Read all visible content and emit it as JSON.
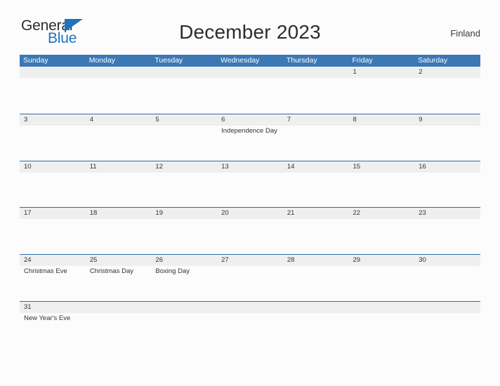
{
  "brand": {
    "word_one": "General",
    "word_two": "Blue",
    "triangle_icon": "blue-triangle-icon",
    "color_dark": "#2b2b2b",
    "color_blue": "#1e73be"
  },
  "header": {
    "title": "December 2023",
    "region": "Finland"
  },
  "colors": {
    "header_blue": "#3b78b4",
    "row_line_blue": "#2c6ca8",
    "band_gray": "#efefef",
    "page_bg": "#fcfcfc",
    "text": "#333333"
  },
  "calendar": {
    "weekdays": [
      "Sunday",
      "Monday",
      "Tuesday",
      "Wednesday",
      "Thursday",
      "Friday",
      "Saturday"
    ],
    "weeks": [
      [
        {
          "day": "",
          "event": ""
        },
        {
          "day": "",
          "event": ""
        },
        {
          "day": "",
          "event": ""
        },
        {
          "day": "",
          "event": ""
        },
        {
          "day": "",
          "event": ""
        },
        {
          "day": "1",
          "event": ""
        },
        {
          "day": "2",
          "event": ""
        }
      ],
      [
        {
          "day": "3",
          "event": ""
        },
        {
          "day": "4",
          "event": ""
        },
        {
          "day": "5",
          "event": ""
        },
        {
          "day": "6",
          "event": "Independence Day"
        },
        {
          "day": "7",
          "event": ""
        },
        {
          "day": "8",
          "event": ""
        },
        {
          "day": "9",
          "event": ""
        }
      ],
      [
        {
          "day": "10",
          "event": ""
        },
        {
          "day": "11",
          "event": ""
        },
        {
          "day": "12",
          "event": ""
        },
        {
          "day": "13",
          "event": ""
        },
        {
          "day": "14",
          "event": ""
        },
        {
          "day": "15",
          "event": ""
        },
        {
          "day": "16",
          "event": ""
        }
      ],
      [
        {
          "day": "17",
          "event": ""
        },
        {
          "day": "18",
          "event": ""
        },
        {
          "day": "19",
          "event": ""
        },
        {
          "day": "20",
          "event": ""
        },
        {
          "day": "21",
          "event": ""
        },
        {
          "day": "22",
          "event": ""
        },
        {
          "day": "23",
          "event": ""
        }
      ],
      [
        {
          "day": "24",
          "event": "Christmas Eve"
        },
        {
          "day": "25",
          "event": "Christmas Day"
        },
        {
          "day": "26",
          "event": "Boxing Day"
        },
        {
          "day": "27",
          "event": ""
        },
        {
          "day": "28",
          "event": ""
        },
        {
          "day": "29",
          "event": ""
        },
        {
          "day": "30",
          "event": ""
        }
      ],
      [
        {
          "day": "31",
          "event": "New Year's Eve"
        },
        {
          "day": "",
          "event": ""
        },
        {
          "day": "",
          "event": ""
        },
        {
          "day": "",
          "event": ""
        },
        {
          "day": "",
          "event": ""
        },
        {
          "day": "",
          "event": ""
        },
        {
          "day": "",
          "event": ""
        }
      ]
    ]
  }
}
